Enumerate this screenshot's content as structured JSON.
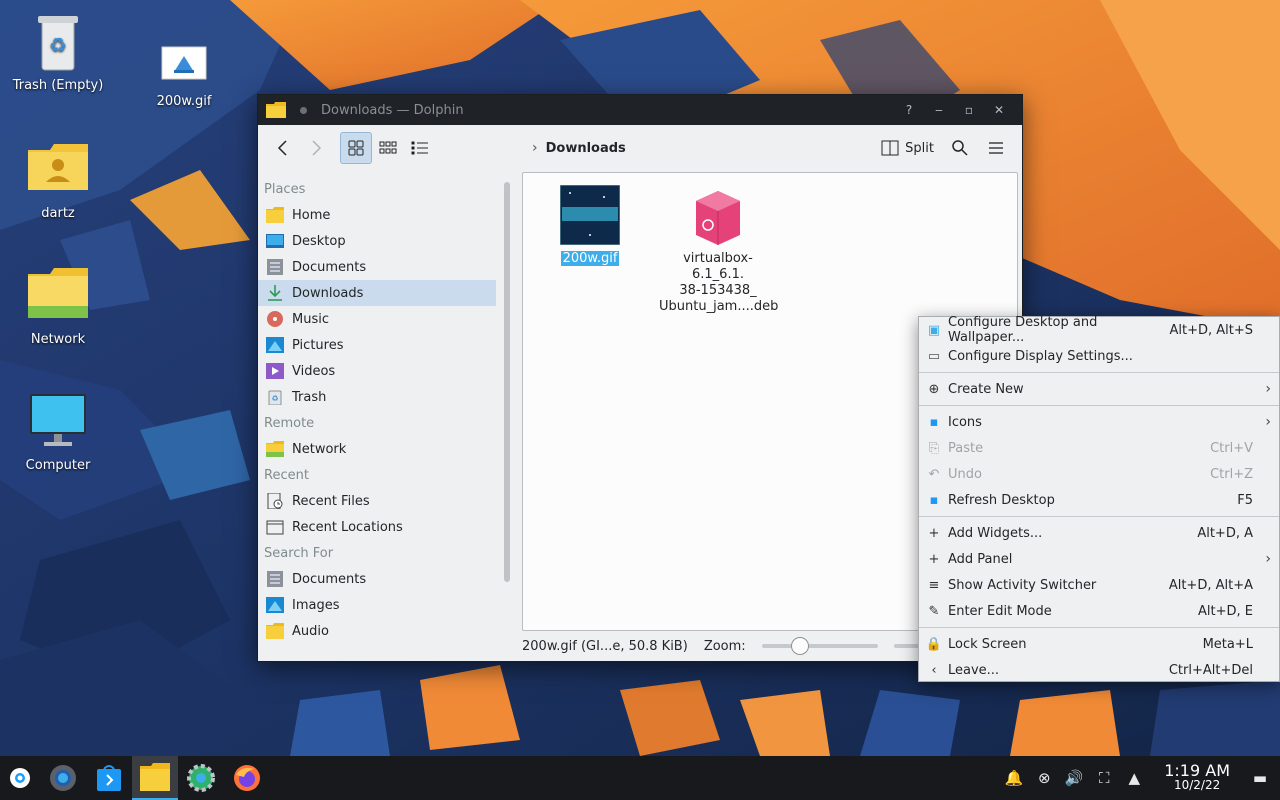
{
  "desktop": {
    "icons": [
      {
        "label": "Trash (Empty)",
        "icon": "trash-icon"
      },
      {
        "label": "200w.gif",
        "icon": "image-file-icon"
      },
      {
        "label": "dartz",
        "icon": "home-folder-icon"
      },
      {
        "label": "Network",
        "icon": "network-folder-icon"
      },
      {
        "label": "Computer",
        "icon": "computer-icon"
      }
    ]
  },
  "window": {
    "title": "Downloads — Dolphin",
    "breadcrumb": "Downloads",
    "split_label": "Split",
    "places": {
      "sections": {
        "places": "Places",
        "remote": "Remote",
        "recent": "Recent",
        "search": "Search For"
      },
      "items": [
        {
          "label": "Home",
          "icon": "folder-icon"
        },
        {
          "label": "Desktop",
          "icon": "desktop-icon"
        },
        {
          "label": "Documents",
          "icon": "documents-icon"
        },
        {
          "label": "Downloads",
          "icon": "downloads-icon",
          "selected": true
        },
        {
          "label": "Music",
          "icon": "music-icon"
        },
        {
          "label": "Pictures",
          "icon": "pictures-icon"
        },
        {
          "label": "Videos",
          "icon": "videos-icon"
        },
        {
          "label": "Trash",
          "icon": "trash-icon"
        }
      ],
      "remote_items": [
        {
          "label": "Network",
          "icon": "network-folder-icon"
        }
      ],
      "recent_items": [
        {
          "label": "Recent Files",
          "icon": "recent-files-icon"
        },
        {
          "label": "Recent Locations",
          "icon": "recent-locations-icon"
        }
      ],
      "search_items": [
        {
          "label": "Documents",
          "icon": "documents-icon"
        },
        {
          "label": "Images",
          "icon": "pictures-icon"
        },
        {
          "label": "Audio",
          "icon": "folder-icon"
        }
      ]
    },
    "files": [
      {
        "name": "200w.gif",
        "selected": true
      },
      {
        "name_lines": [
          "virtualbox-6.1_6.1.",
          "38-153438_",
          "Ubuntu_jam....deb"
        ]
      }
    ],
    "status": {
      "info": "200w.gif (GI...e, 50.8 KiB)",
      "zoom_label": "Zoom:",
      "zoom_level": 0.3
    }
  },
  "context_menu": {
    "items": [
      {
        "label": "Configure Desktop and Wallpaper...",
        "shortcut": "Alt+D, Alt+S",
        "icon": "wallpaper-icon"
      },
      {
        "label": "Configure Display Settings...",
        "shortcut": "",
        "icon": "display-icon"
      },
      {
        "label": "Create New",
        "shortcut": "",
        "icon": "create-new-icon",
        "submenu": true
      },
      {
        "label": "Icons",
        "shortcut": "",
        "icon": "icons-icon",
        "submenu": true
      },
      {
        "label": "Paste",
        "shortcut": "Ctrl+V",
        "icon": "paste-icon",
        "disabled": true
      },
      {
        "label": "Undo",
        "shortcut": "Ctrl+Z",
        "icon": "undo-icon",
        "disabled": true
      },
      {
        "label": "Refresh Desktop",
        "shortcut": "F5",
        "icon": "refresh-icon"
      },
      {
        "label": "Add Widgets...",
        "shortcut": "Alt+D, A",
        "icon": "plus-icon"
      },
      {
        "label": "Add Panel",
        "shortcut": "",
        "icon": "plus-icon",
        "submenu": true
      },
      {
        "label": "Show Activity Switcher",
        "shortcut": "Alt+D, Alt+A",
        "icon": "activities-icon"
      },
      {
        "label": "Enter Edit Mode",
        "shortcut": "Alt+D, E",
        "icon": "pencil-icon"
      },
      {
        "label": "Lock Screen",
        "shortcut": "Meta+L",
        "icon": "lock-icon"
      },
      {
        "label": "Leave...",
        "shortcut": "Ctrl+Alt+Del",
        "icon": "leave-icon"
      }
    ]
  },
  "taskbar": {
    "apps": [
      "steam-icon",
      "settings-discover-icon",
      "discover-icon",
      "dolphin-icon",
      "system-settings-icon",
      "firefox-icon"
    ],
    "clock": {
      "time": "1:19 AM",
      "date": "10/2/22"
    }
  }
}
